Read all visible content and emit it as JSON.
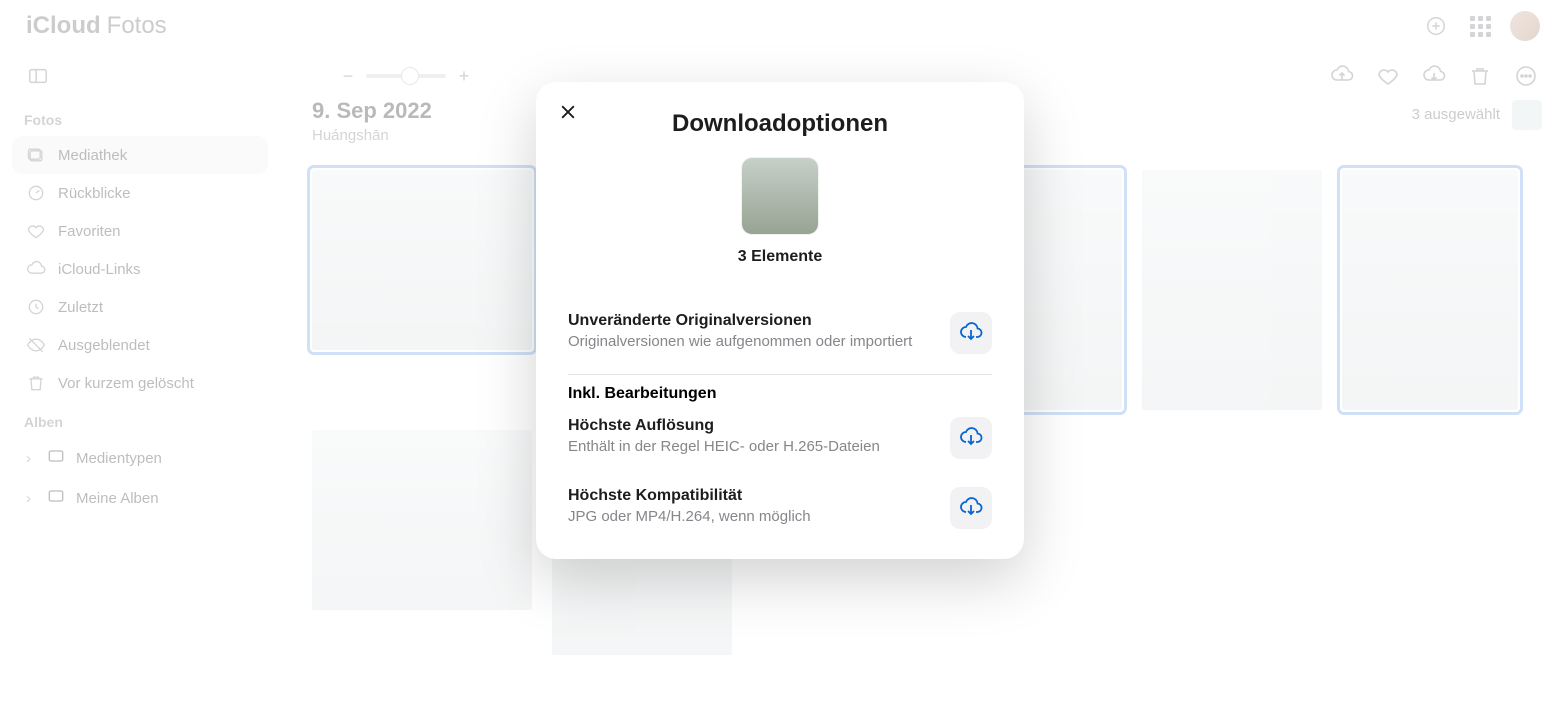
{
  "brand": {
    "cloud": "iCloud",
    "app": "Fotos"
  },
  "sidebar": {
    "heading_photos": "Fotos",
    "items": [
      {
        "label": "Mediathek"
      },
      {
        "label": "Rückblicke"
      },
      {
        "label": "Favoriten"
      },
      {
        "label": "iCloud-Links"
      },
      {
        "label": "Zuletzt"
      },
      {
        "label": "Ausgeblendet"
      },
      {
        "label": "Vor kurzem gelöscht"
      }
    ],
    "heading_albums": "Alben",
    "albums": [
      {
        "label": "Medientypen"
      },
      {
        "label": "Meine Alben"
      }
    ]
  },
  "content": {
    "date": "9. Sep 2022",
    "location": "Huángshān",
    "selection": "3 ausgewählt"
  },
  "modal": {
    "title": "Downloadoptionen",
    "count": "3 Elemente",
    "opt_original_title": "Unveränderte Originalversionen",
    "opt_original_desc": "Originalversionen wie aufgenommen oder importiert",
    "section_edits": "Inkl. Bearbeitungen",
    "opt_hires_title": "Höchste Auflösung",
    "opt_hires_desc": "Enthält in der Regel HEIC- oder H.265-Dateien",
    "opt_compat_title": "Höchste Kompatibilität",
    "opt_compat_desc": "JPG oder MP4/H.264, wenn möglich"
  }
}
